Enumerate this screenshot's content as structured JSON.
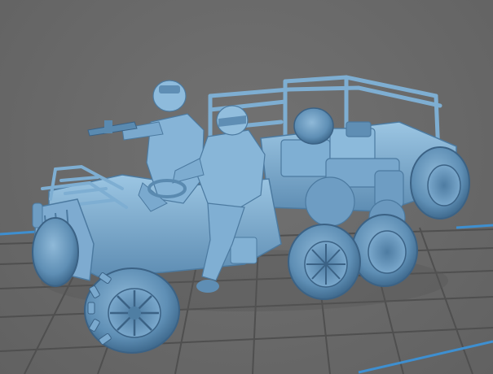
{
  "scene": {
    "subject": "vehicle-model",
    "colors": {
      "background": "#6a6a6a",
      "build_plate_grid": "#4f4f4f",
      "build_plate_border": "#3e8fd0",
      "model_light": "#8fbcdc",
      "model_mid": "#6f9fc4",
      "model_dark": "#4f7ea3",
      "model_shadow": "#3b6285"
    }
  }
}
